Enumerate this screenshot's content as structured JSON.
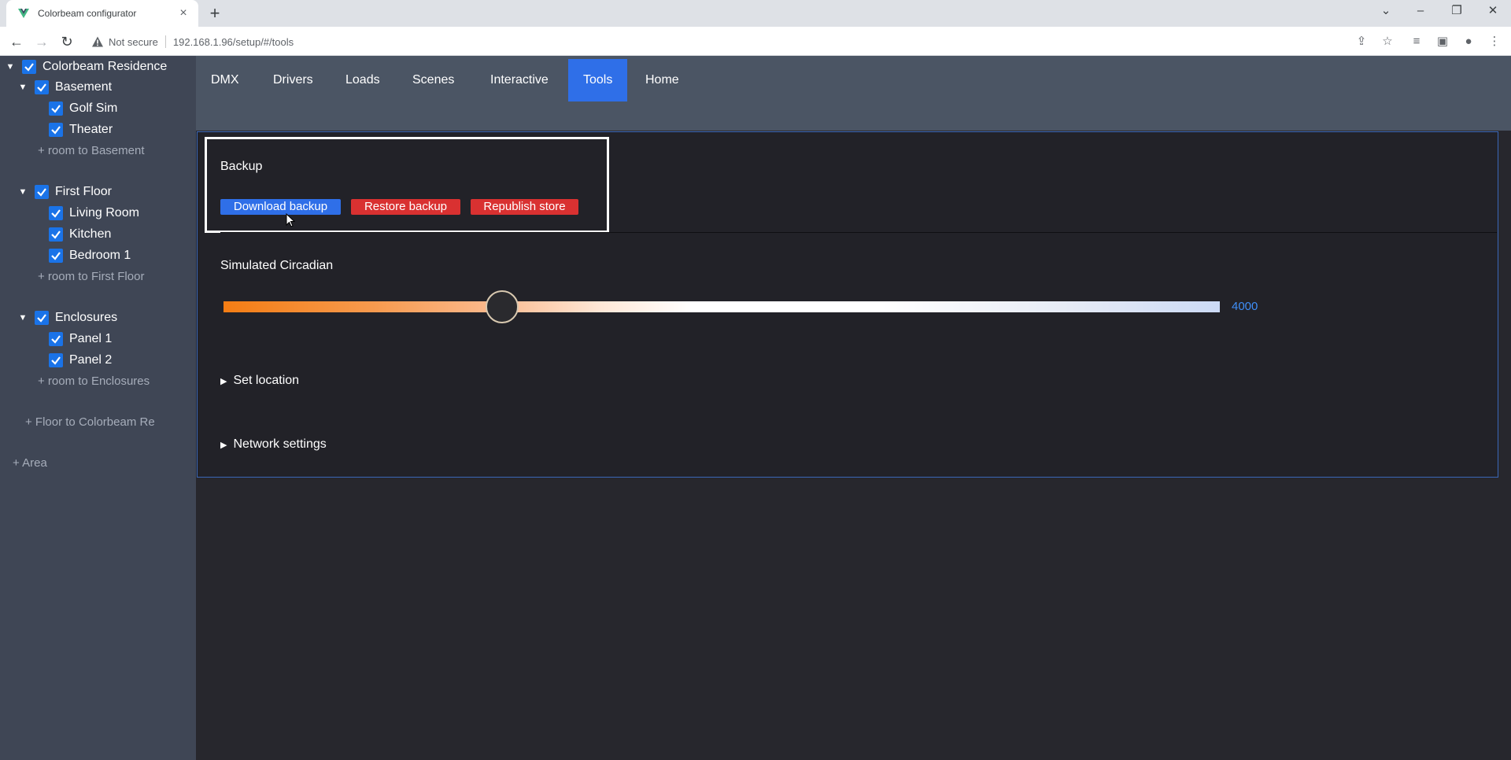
{
  "browser": {
    "tab_title": "Colorbeam configurator",
    "tab_close": "×",
    "new_tab": "+",
    "security_label": "Not secure",
    "url": "192.168.1.96/setup/#/tools"
  },
  "sidebar": {
    "areas": [
      {
        "label": "Colorbeam Residence",
        "floors": [
          {
            "label": "Basement",
            "rooms": [
              "Golf Sim",
              "Theater"
            ],
            "add_room": "+ room to Basement"
          },
          {
            "label": "First Floor",
            "rooms": [
              "Living Room",
              "Kitchen",
              "Bedroom 1"
            ],
            "add_room": "+ room to First Floor"
          },
          {
            "label": "Enclosures",
            "rooms": [
              "Panel 1",
              "Panel 2"
            ],
            "add_room": "+ room to Enclosures"
          }
        ],
        "add_floor": "+ Floor to Colorbeam Re"
      }
    ],
    "add_area": "+ Area"
  },
  "topnav": {
    "items": [
      "DMX",
      "Drivers",
      "Loads",
      "Scenes",
      "Interactive",
      "Tools",
      "Home"
    ],
    "active": "Tools"
  },
  "tools": {
    "backup": {
      "title": "Backup",
      "download_label": "Download backup",
      "restore_label": "Restore backup",
      "republish_label": "Republish store"
    },
    "circadian": {
      "title": "Simulated Circadian",
      "value": "4000",
      "slider_fraction": 0.28
    },
    "set_location_label": "Set location",
    "network_settings_label": "Network settings"
  },
  "colors": {
    "accent_blue": "#2f6fe8",
    "danger_red": "#d93131",
    "checkbox_blue": "#1a73e8"
  }
}
